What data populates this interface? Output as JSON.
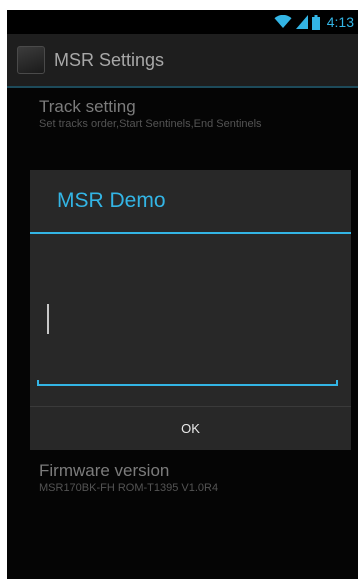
{
  "status_bar": {
    "time": "4:13",
    "icons": [
      "wifi-icon",
      "signal-icon",
      "battery-icon"
    ]
  },
  "action_bar": {
    "title": "MSR Settings",
    "icon": "app-icon"
  },
  "preferences": [
    {
      "title": "Track setting",
      "summary": "Set tracks order,Start Sentinels,End Sentinels"
    },
    {
      "title": "Firmware version",
      "summary": "MSR170BK-FH ROM-T1395 V1.0R4"
    }
  ],
  "dialog": {
    "title": "MSR Demo",
    "input_value": "",
    "ok_label": "OK"
  },
  "colors": {
    "accent": "#33b5e5",
    "background": "#050505",
    "dialog": "#282828"
  }
}
